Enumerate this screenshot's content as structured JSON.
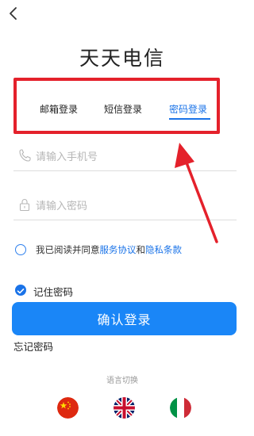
{
  "app": {
    "title": "天天电信"
  },
  "tabs": [
    {
      "label": "邮箱登录",
      "active": false
    },
    {
      "label": "短信登录",
      "active": false
    },
    {
      "label": "密码登录",
      "active": true
    }
  ],
  "fields": {
    "phone": {
      "placeholder": "请输入手机号",
      "icon": "phone-icon"
    },
    "password": {
      "placeholder": "请输入密码",
      "icon": "lock-icon"
    }
  },
  "agreement": {
    "prefix": "我已阅读并同意",
    "service_link": "服务协议",
    "and": "和",
    "privacy_link": "隐私条款",
    "checked": false
  },
  "remember": {
    "label": "记住密码",
    "checked": true
  },
  "login_button": {
    "label": "确认登录"
  },
  "forgot_password": {
    "label": "忘记密码"
  },
  "language": {
    "label": "语言切换",
    "flags": [
      "china-flag-icon",
      "uk-flag-icon",
      "italy-flag-icon"
    ]
  },
  "colors": {
    "accent": "#1a73e8",
    "button": "#1a86f7",
    "annotation_red": "#e4212b"
  }
}
